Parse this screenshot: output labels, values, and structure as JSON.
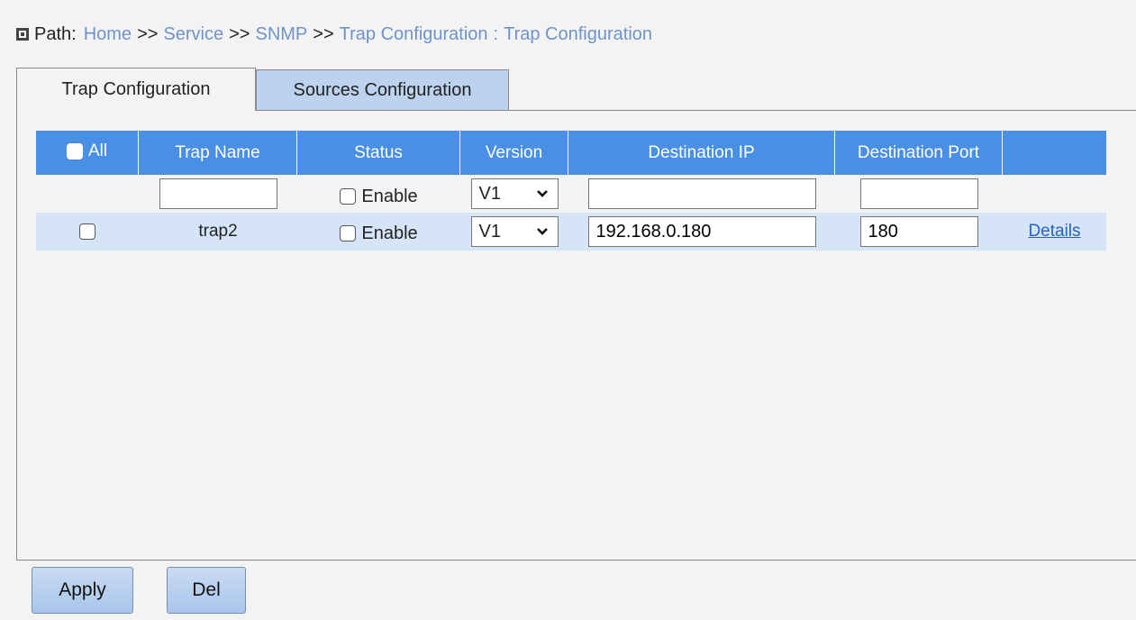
{
  "path": {
    "label": "Path:",
    "crumbs": [
      "Home",
      "Service",
      "SNMP",
      "Trap Configuration"
    ],
    "separator": ">>",
    "colon": ":",
    "current": "Trap Configuration"
  },
  "tabs": [
    {
      "label": "Trap Configuration",
      "active": true
    },
    {
      "label": "Sources Configuration",
      "active": false
    }
  ],
  "table": {
    "headers": {
      "all": "All",
      "trap_name": "Trap Name",
      "status": "Status",
      "version": "Version",
      "destination_ip": "Destination IP",
      "destination_port": "Destination Port"
    },
    "filter_row": {
      "trap_name": "",
      "enable_label": "Enable",
      "version": "V1",
      "destination_ip": "",
      "destination_port": ""
    },
    "rows": [
      {
        "trap_name": "trap2",
        "enable_label": "Enable",
        "version": "V1",
        "destination_ip": "192.168.0.180",
        "destination_port": "180",
        "details": "Details"
      }
    ]
  },
  "buttons": {
    "apply": "Apply",
    "del": "Del"
  },
  "colors": {
    "header_blue": "#4a8fe6",
    "row_blue": "#d6e4f7",
    "tab_inactive": "#bcd2ee",
    "link_blue": "#2563bf",
    "breadcrumb": "#6f93c9"
  }
}
